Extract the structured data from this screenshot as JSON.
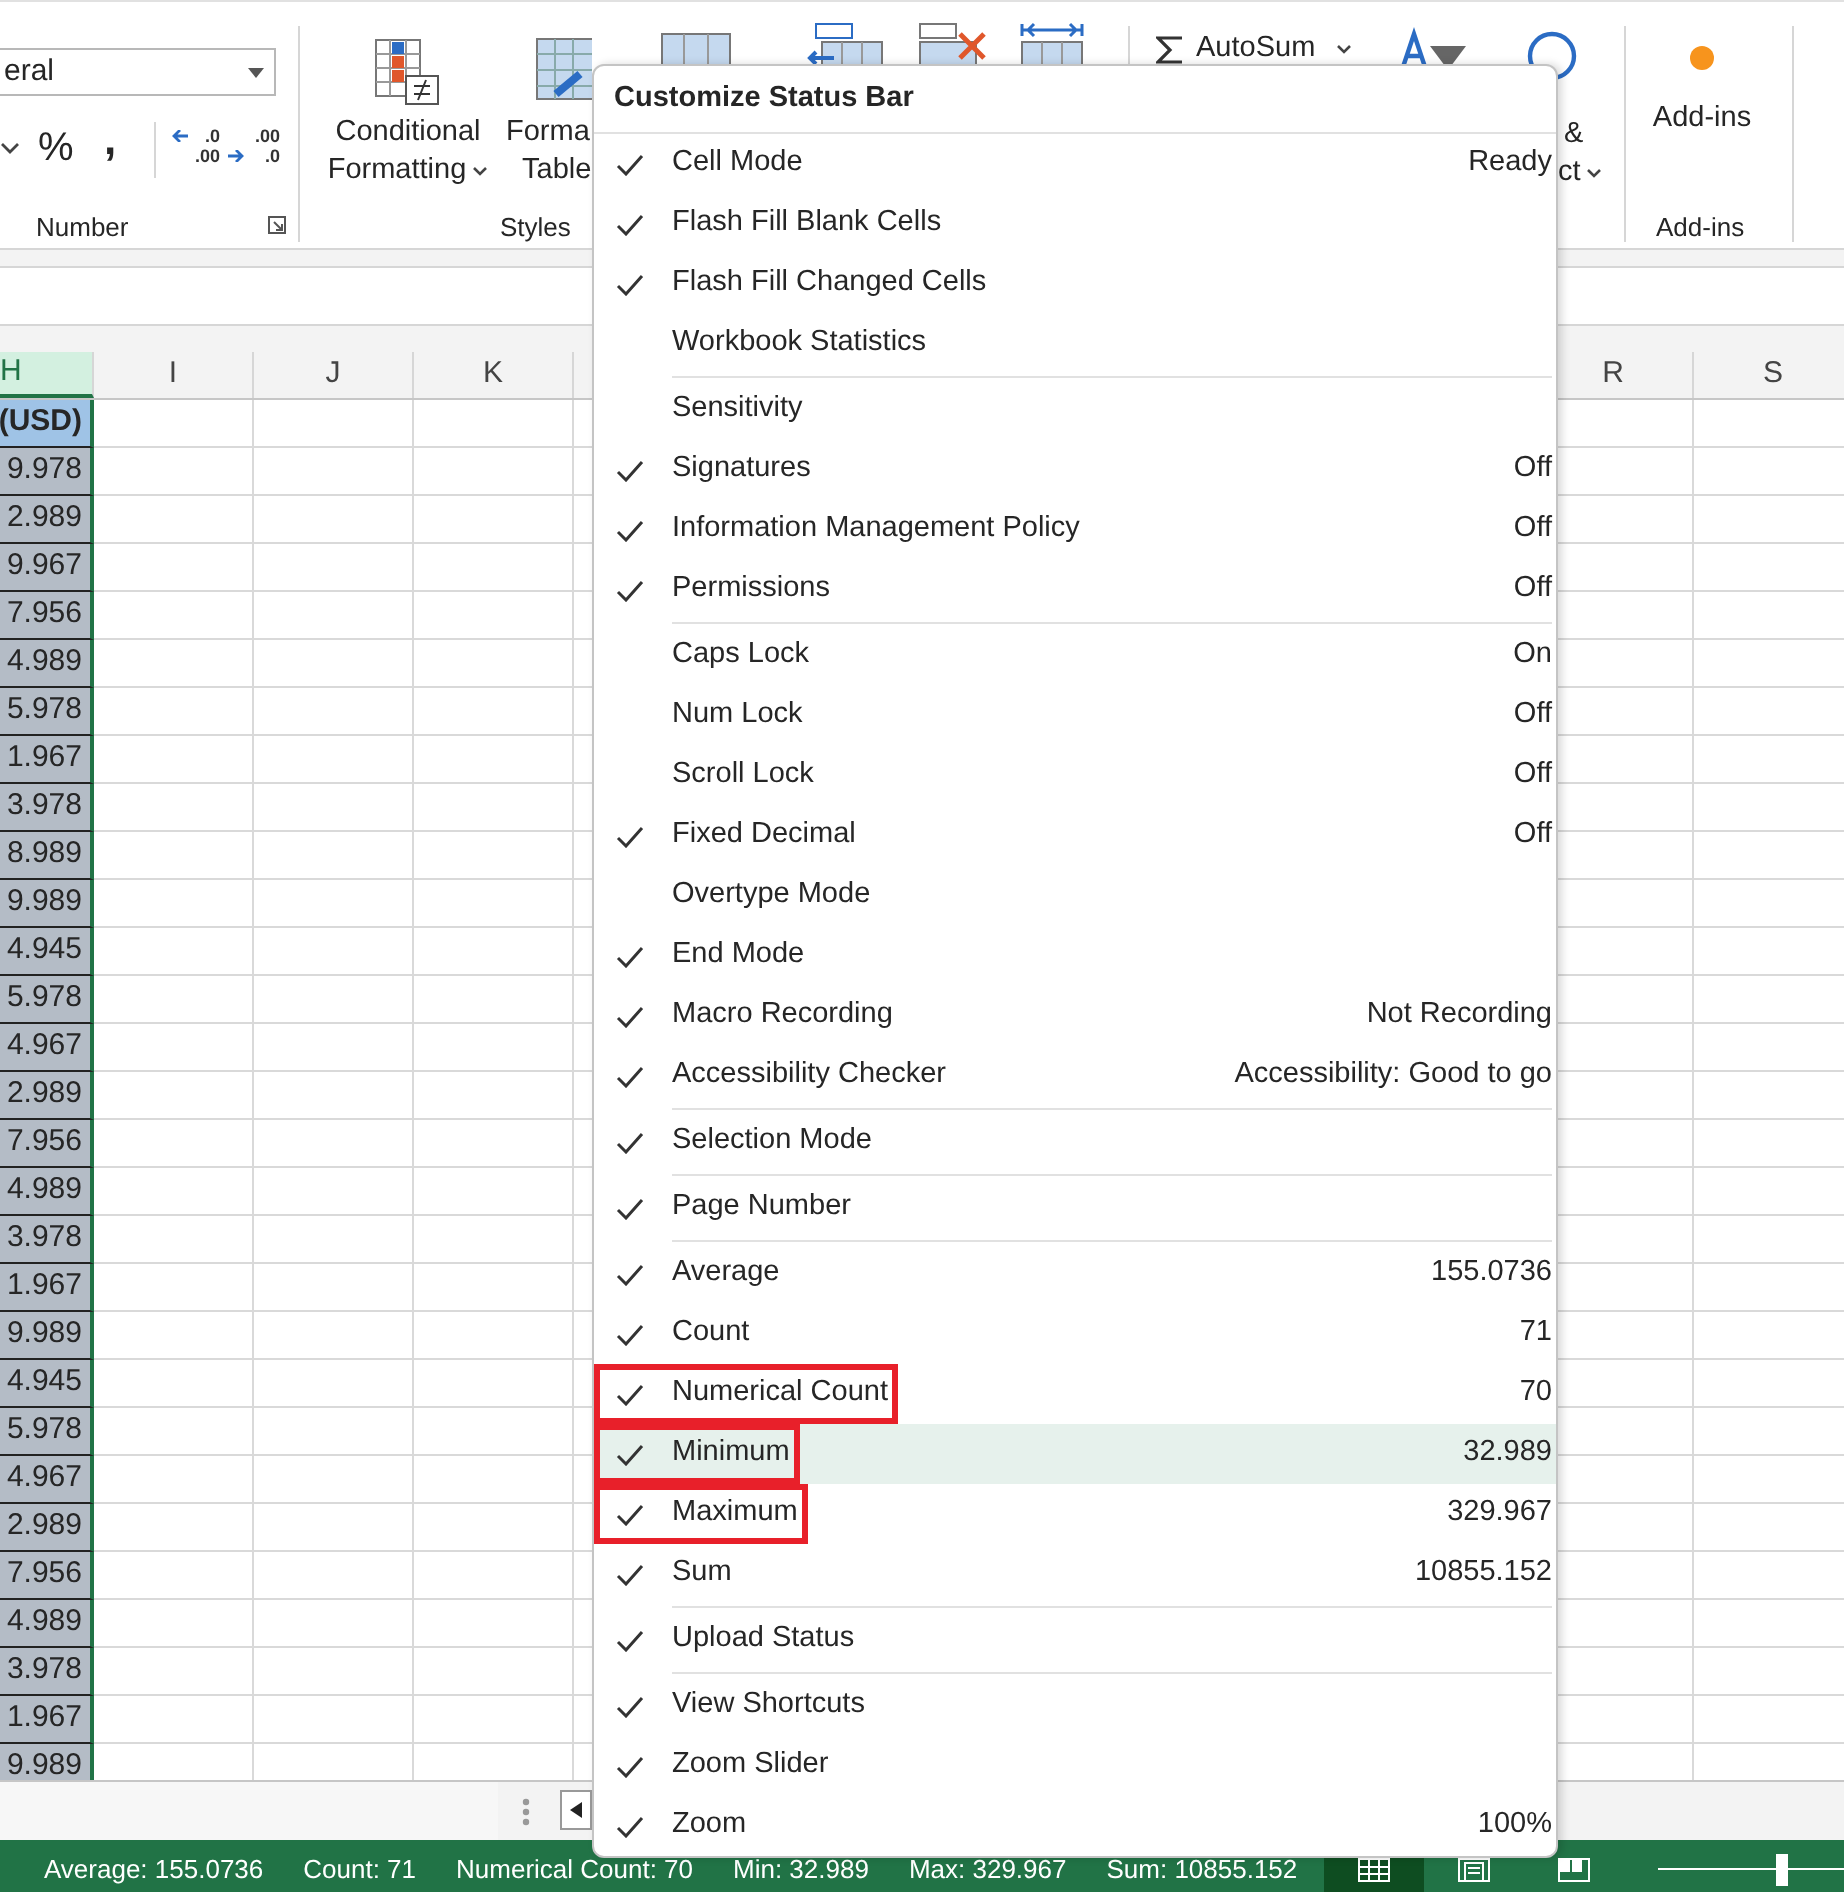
{
  "ribbon": {
    "number_format": {
      "value": "eral"
    },
    "number_symbols": [
      "%",
      ","
    ],
    "decimal_buttons": [
      {
        "kind": "increase",
        "top": ".0",
        "bottom": ".00"
      },
      {
        "kind": "decrease",
        "top": ".00",
        "bottom": ".0"
      }
    ],
    "conditional_formatting": [
      "Conditional",
      "Formatting"
    ],
    "format_as_table": [
      "Forma",
      "Table"
    ],
    "autosum": "AutoSum",
    "find_select": [
      "&",
      "ct"
    ],
    "add_ins": "Add-ins",
    "group_labels": [
      "Number",
      "Styles",
      "Add-ins"
    ]
  },
  "sheet": {
    "columns": [
      {
        "letter": "H",
        "selected": true
      },
      {
        "letter": "I",
        "selected": false
      },
      {
        "letter": "J",
        "selected": false
      },
      {
        "letter": "K",
        "selected": false
      },
      {
        "letter": "R",
        "selected": false
      },
      {
        "letter": "S",
        "selected": false
      }
    ],
    "header_cell": "(USD)",
    "values": [
      "9.978",
      "2.989",
      "9.967",
      "7.956",
      "4.989",
      "5.978",
      "1.967",
      "3.978",
      "8.989",
      "9.989",
      "4.945",
      "5.978",
      "4.967",
      "2.989",
      "7.956",
      "4.989",
      "3.978",
      "1.967",
      "9.989",
      "4.945",
      "5.978",
      "4.967",
      "2.989",
      "7.956",
      "4.989",
      "3.978",
      "1.967",
      "9.989"
    ]
  },
  "menu": {
    "title": "Customize Status Bar",
    "groups": [
      [
        {
          "label": "Cell Mode",
          "checked": true,
          "value": "Ready",
          "highlighted": false,
          "annotated": false
        },
        {
          "label": "Flash Fill Blank Cells",
          "checked": true,
          "highlighted": false,
          "annotated": false
        },
        {
          "label": "Flash Fill Changed Cells",
          "checked": true,
          "highlighted": false,
          "annotated": false
        },
        {
          "label": "Workbook Statistics",
          "checked": false,
          "highlighted": false,
          "annotated": false
        }
      ],
      [
        {
          "label": "Sensitivity",
          "checked": false,
          "highlighted": false,
          "annotated": false
        },
        {
          "label": "Signatures",
          "checked": true,
          "value": "Off",
          "highlighted": false,
          "annotated": false
        },
        {
          "label": "Information Management Policy",
          "checked": true,
          "value": "Off",
          "highlighted": false,
          "annotated": false
        },
        {
          "label": "Permissions",
          "checked": true,
          "value": "Off",
          "highlighted": false,
          "annotated": false
        }
      ],
      [
        {
          "label": "Caps Lock",
          "checked": false,
          "value": "On",
          "highlighted": false,
          "annotated": false
        },
        {
          "label": "Num Lock",
          "checked": false,
          "value": "Off",
          "highlighted": false,
          "annotated": false
        },
        {
          "label": "Scroll Lock",
          "checked": false,
          "value": "Off",
          "highlighted": false,
          "annotated": false
        },
        {
          "label": "Fixed Decimal",
          "checked": true,
          "value": "Off",
          "highlighted": false,
          "annotated": false
        },
        {
          "label": "Overtype Mode",
          "checked": false,
          "highlighted": false,
          "annotated": false
        },
        {
          "label": "End Mode",
          "checked": true,
          "highlighted": false,
          "annotated": false
        },
        {
          "label": "Macro Recording",
          "checked": true,
          "value": "Not Recording",
          "highlighted": false,
          "annotated": false
        },
        {
          "label": "Accessibility Checker",
          "checked": true,
          "value": "Accessibility: Good to go",
          "highlighted": false,
          "annotated": false
        }
      ],
      [
        {
          "label": "Selection Mode",
          "checked": true,
          "highlighted": false,
          "annotated": false
        }
      ],
      [
        {
          "label": "Page Number",
          "checked": true,
          "highlighted": false,
          "annotated": false
        }
      ],
      [
        {
          "label": "Average",
          "checked": true,
          "value": "155.0736",
          "highlighted": false,
          "annotated": false
        },
        {
          "label": "Count",
          "checked": true,
          "value": "71",
          "highlighted": false,
          "annotated": false
        },
        {
          "label": "Numerical Count",
          "checked": true,
          "value": "70",
          "highlighted": false,
          "annotated": true
        },
        {
          "label": "Minimum",
          "checked": true,
          "value": "32.989",
          "highlighted": true,
          "annotated": true
        },
        {
          "label": "Maximum",
          "checked": true,
          "value": "329.967",
          "highlighted": false,
          "annotated": true
        },
        {
          "label": "Sum",
          "checked": true,
          "value": "10855.152",
          "highlighted": false,
          "annotated": false
        }
      ],
      [
        {
          "label": "Upload Status",
          "checked": true,
          "highlighted": false,
          "annotated": false
        }
      ],
      [
        {
          "label": "View Shortcuts",
          "checked": true,
          "highlighted": false,
          "annotated": false
        },
        {
          "label": "Zoom Slider",
          "checked": true,
          "highlighted": false,
          "annotated": false
        },
        {
          "label": "Zoom",
          "checked": true,
          "value": "100%",
          "highlighted": false,
          "annotated": false
        }
      ]
    ]
  },
  "status_bar": {
    "items": [
      "Average: 155.0736",
      "Count: 71",
      "Numerical Count: 70",
      "Min: 32.989",
      "Max: 329.967",
      "Sum: 10855.152"
    ],
    "views": [
      {
        "kind": "normal",
        "selected": true
      },
      {
        "kind": "page_layout",
        "selected": false
      },
      {
        "kind": "page_break",
        "selected": false
      }
    ],
    "zoom": {
      "level": 0.5
    }
  }
}
